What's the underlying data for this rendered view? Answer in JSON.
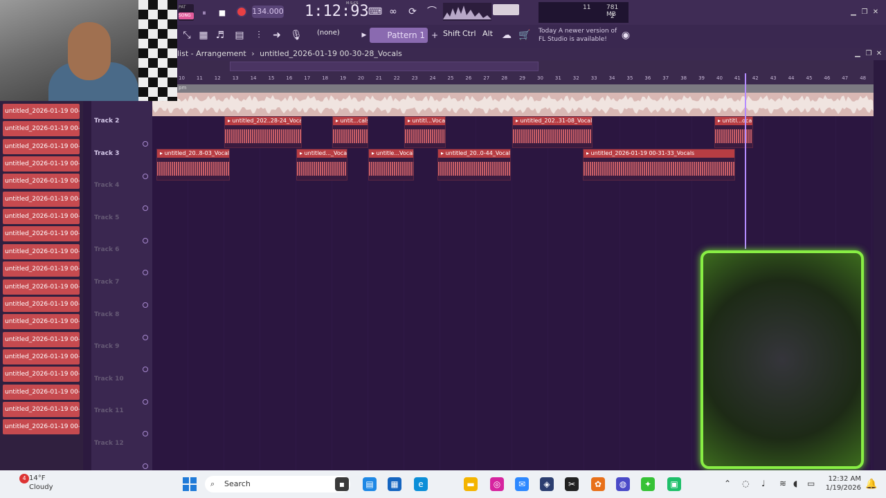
{
  "transport": {
    "song_tag_top": "PAT",
    "song_tag_bottom": "SONG",
    "pause_symbol": "⏸",
    "stop_symbol": "■",
    "tempo": "134.000",
    "time": "1:12:93",
    "time_unit": "M:S:CS"
  },
  "toolbar": {
    "pattern_selector": "(none)",
    "pattern_name": "Pattern 1",
    "pattern_add": "+",
    "keys": [
      "Shift",
      "Ctrl",
      "Alt"
    ],
    "cpu_value": "11",
    "memory_value": "781 MB",
    "poly_value": "2",
    "news_date": "Today",
    "news_line1": "A newer version of",
    "news_line2": "FL Studio is available!"
  },
  "arrangement": {
    "title_prefix": "list - Arrangement",
    "title_separator": "›",
    "title_name": "untitled_2026-01-19 00-30-28_Vocals",
    "ruler_bars": [
      "10",
      "11",
      "12",
      "13",
      "14",
      "15",
      "16",
      "17",
      "18",
      "19",
      "20",
      "21",
      "22",
      "23",
      "24",
      "25",
      "26",
      "27",
      "28",
      "29",
      "30",
      "31",
      "32",
      "33",
      "34",
      "35",
      "36",
      "37",
      "38",
      "39",
      "40",
      "41",
      "42",
      "43",
      "44",
      "45",
      "46",
      "47",
      "48"
    ],
    "marker_label": "pm"
  },
  "left_panel": {
    "items": [
      "untitled_2026-01-19 00-...",
      "untitled_2026-01-19 00-...",
      "untitled_2026-01-19 00-...",
      "untitled_2026-01-19 00-...",
      "untitled_2026-01-19 00-...",
      "untitled_2026-01-19 00-...",
      "untitled_2026-01-19 00-...",
      "untitled_2026-01-19 00-...",
      "untitled_2026-01-19 00-...",
      "untitled_2026-01-19 00-...",
      "untitled_2026-01-19 00-...",
      "untitled_2026-01-19 00-...",
      "untitled_2026-01-19 00-...",
      "untitled_2026-01-19 00-...",
      "untitled_2026-01-19 00-...",
      "untitled_2026-01-19 00-...",
      "untitled_2026-01-19 00-...",
      "untitled_2026-01-19 00-...",
      "untitled_2026-01-19 00-..."
    ]
  },
  "tracks": {
    "labels": [
      "Track 2",
      "Track 3",
      "Track 4",
      "Track 5",
      "Track 6",
      "Track 7",
      "Track 8",
      "Track 9",
      "Track 10",
      "Track 11",
      "Track 12"
    ]
  },
  "clips": {
    "track2": [
      "▸ untitled_202..28-24_Vocals",
      "▸ untit...cals",
      "▸ untitl...Vocals",
      "▸ untitled_202..31-08_Vocals",
      "▸ untitl...ocals"
    ],
    "track3": [
      "▸ untitled_20..8-03_Vocals",
      "▸ untitled..._Vocals",
      "▸ untitle...Vocals",
      "▸ untitled_20..0-44_Vocals",
      "▸ untitled_2026-01-19 00-31-33_Vocals"
    ]
  },
  "taskbar": {
    "weather_badge": "4",
    "temperature": "14°F",
    "condition": "Cloudy",
    "search_label": "Search",
    "time": "12:32 AM",
    "date": "1/19/2026"
  },
  "colors": {
    "clip_header": "#b83d43",
    "left_item": "#c64a4f",
    "overlay_border": "#88ee44",
    "playhead": "#b48cff"
  }
}
